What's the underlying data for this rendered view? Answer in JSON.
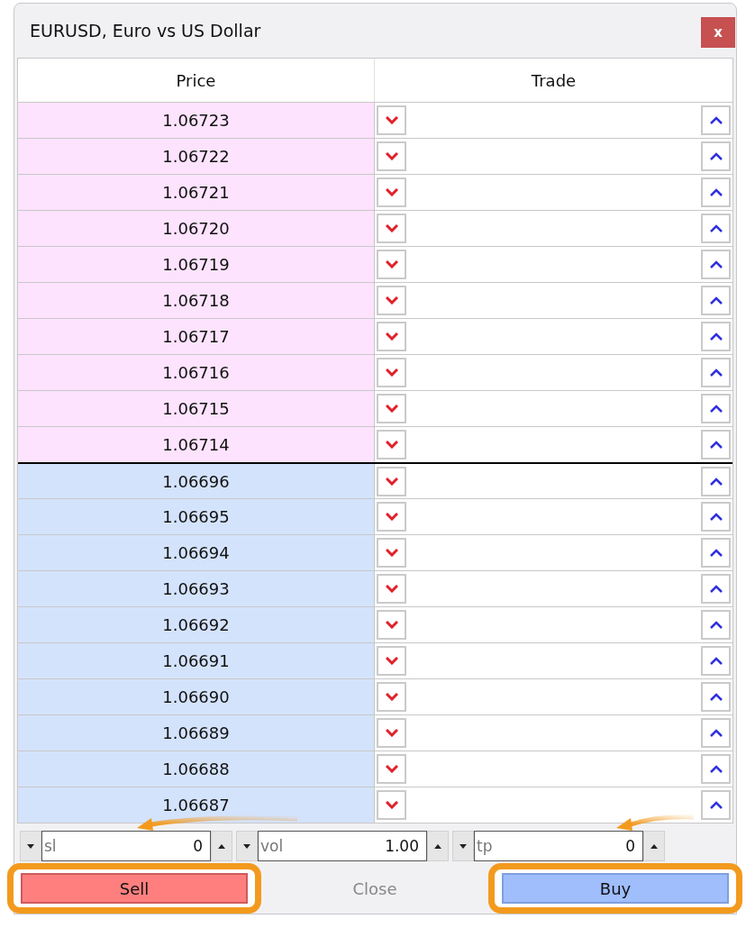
{
  "window": {
    "title": "EURUSD, Euro vs US Dollar",
    "close_label": "x"
  },
  "table": {
    "columns": [
      "Price",
      "Trade"
    ],
    "rows": [
      {
        "price": "1.06723",
        "color": "#fde3fd"
      },
      {
        "price": "1.06722",
        "color": "#fde3fd"
      },
      {
        "price": "1.06721",
        "color": "#fde3fd"
      },
      {
        "price": "1.06720",
        "color": "#fde3fd"
      },
      {
        "price": "1.06719",
        "color": "#fde3fd"
      },
      {
        "price": "1.06718",
        "color": "#fde3fd"
      },
      {
        "price": "1.06717",
        "color": "#fde3fd"
      },
      {
        "price": "1.06716",
        "color": "#fde3fd"
      },
      {
        "price": "1.06715",
        "color": "#fde3fd"
      },
      {
        "price": "1.06714",
        "color": "#fde3fd"
      },
      {
        "price": "1.06696",
        "color": "#d4e3fc"
      },
      {
        "price": "1.06695",
        "color": "#d4e3fc"
      },
      {
        "price": "1.06694",
        "color": "#d4e3fc"
      },
      {
        "price": "1.06693",
        "color": "#d4e3fc"
      },
      {
        "price": "1.06692",
        "color": "#d4e3fc"
      },
      {
        "price": "1.06691",
        "color": "#d4e3fc"
      },
      {
        "price": "1.06690",
        "color": "#d4e3fc"
      },
      {
        "price": "1.06689",
        "color": "#d4e3fc"
      },
      {
        "price": "1.06688",
        "color": "#d4e3fc"
      },
      {
        "price": "1.06687",
        "color": "#d4e3fc"
      }
    ]
  },
  "spin_fields": [
    {
      "label": "sl",
      "value": "0"
    },
    {
      "label": "vol",
      "value": "1.00"
    },
    {
      "label": "tp",
      "value": "0"
    }
  ],
  "buttons": [
    {
      "label": "Sell",
      "kind": "sell",
      "disabled": false,
      "highlighted": true
    },
    {
      "label": "Close",
      "kind": "close",
      "disabled": true,
      "highlighted": false
    },
    {
      "label": "Buy",
      "kind": "buy",
      "disabled": false,
      "highlighted": true
    }
  ]
}
